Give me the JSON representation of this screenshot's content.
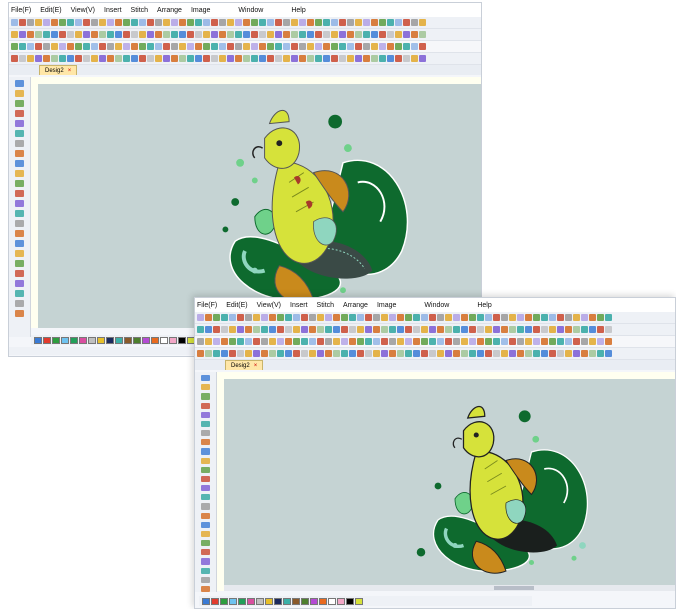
{
  "menu": {
    "file": "File(F)",
    "edit": "Edit(E)",
    "view": "View(V)",
    "insert": "Insert",
    "stitch": "Stitch",
    "arrange": "Arrange",
    "image": "Image",
    "window": "Window",
    "help": "Help"
  },
  "document_tab": {
    "title": "Desig2",
    "close": "×"
  },
  "colors": {
    "canvas": "#c5d3d3",
    "fish_yellow": "#d6e23a",
    "fish_orange": "#c98a1c",
    "dark_green": "#0e6a2e",
    "light_green": "#6fd18a",
    "teal": "#8fd6bf"
  },
  "palette": [
    "#3a7bd5",
    "#e23b2e",
    "#2e9e3f",
    "#6fc3f0",
    "#22a05a",
    "#d94fa0",
    "#c0c0c0",
    "#e7c02b",
    "#1b2a5e",
    "#3bb0a8",
    "#8a5a2b",
    "#4d7f2e",
    "#b44bd4",
    "#e96a1f",
    "#ffffff",
    "#f2a7c7",
    "#000000",
    "#d6e23a"
  ],
  "icons": [
    "new-icon",
    "open-icon",
    "save-icon",
    "print-icon",
    "cut-icon",
    "copy-icon",
    "paste-icon",
    "undo-icon",
    "redo-icon",
    "zoom-in-icon",
    "zoom-out-icon",
    "select-icon",
    "pen-icon",
    "fill-icon",
    "text-icon"
  ]
}
